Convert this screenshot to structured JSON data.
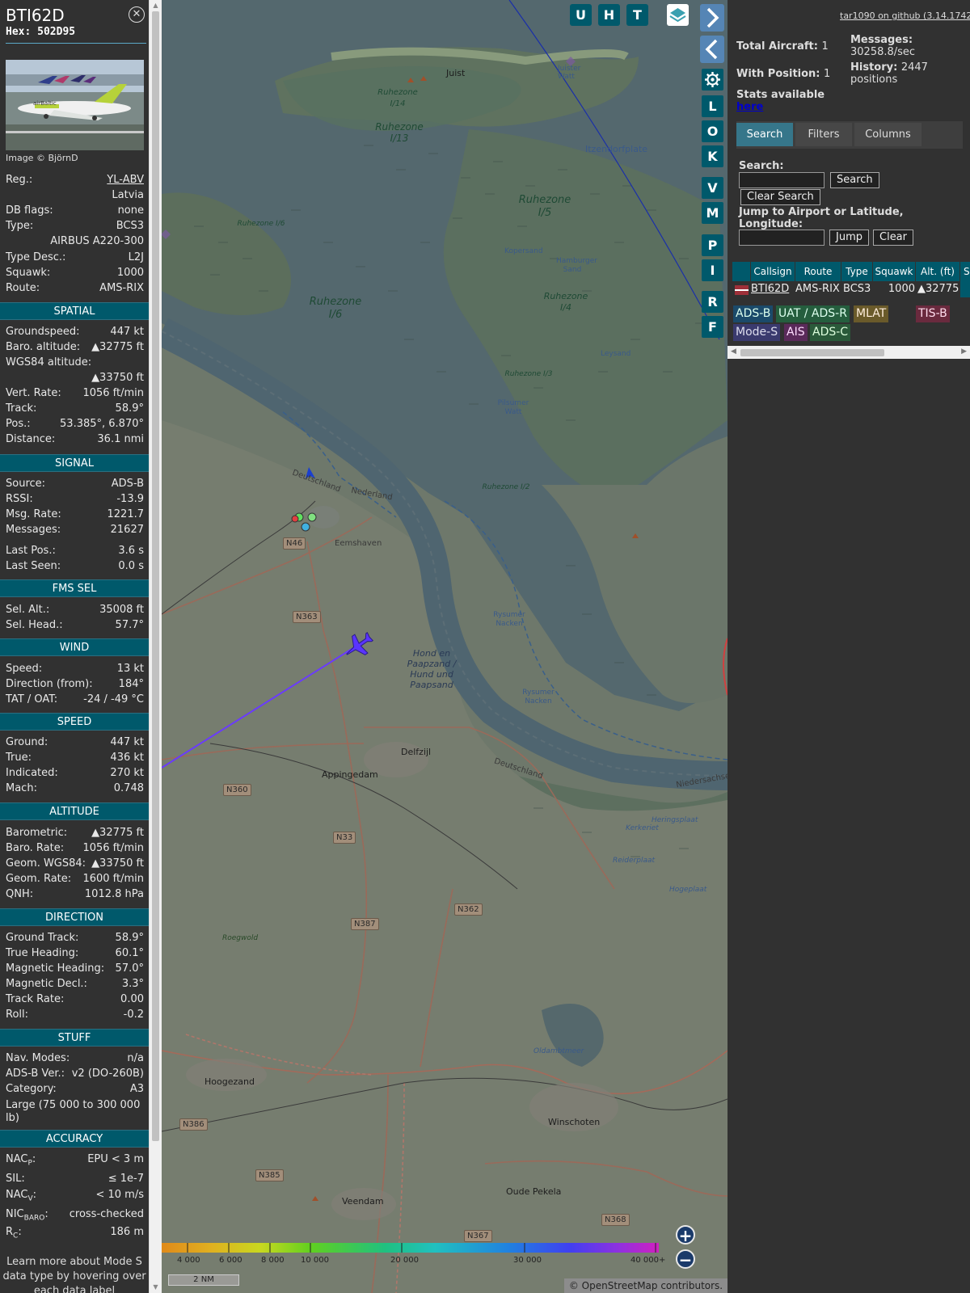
{
  "sidebar": {
    "callsign": "BTI62D",
    "hex": "Hex: 502D95",
    "image_credit": "Image © BjörnD",
    "basic": [
      {
        "k": "Reg.:",
        "v": "YL-ABV"
      },
      {
        "k": "",
        "v": "Latvia"
      },
      {
        "k": "DB flags:",
        "v": "none"
      },
      {
        "k": "Type:",
        "v": "BCS3"
      },
      {
        "k": "",
        "v": "AIRBUS A220-300"
      },
      {
        "k": "Type Desc.:",
        "v": "L2J"
      },
      {
        "k": "Squawk:",
        "v": "1000"
      },
      {
        "k": "Route:",
        "v": "AMS-RIX"
      }
    ],
    "sections": {
      "spatial": "SPATIAL",
      "signal": "SIGNAL",
      "fms": "FMS SEL",
      "wind": "WIND",
      "speed": "SPEED",
      "altitude": "ALTITUDE",
      "direction": "DIRECTION",
      "stuff": "STUFF",
      "accuracy": "ACCURACY"
    },
    "spatial": [
      {
        "k": "Groundspeed:",
        "v": "447 kt"
      },
      {
        "k": "Baro. altitude:",
        "v": "▲32775 ft"
      },
      {
        "k": "WGS84 altitude:",
        "v": ""
      },
      {
        "k": "",
        "v": "▲33750 ft"
      },
      {
        "k": "Vert. Rate:",
        "v": "1056 ft/min"
      },
      {
        "k": "Track:",
        "v": "58.9°"
      },
      {
        "k": "Pos.:",
        "v": "53.385°, 6.870°"
      },
      {
        "k": "Distance:",
        "v": "36.1 nmi"
      }
    ],
    "signal": [
      {
        "k": "Source:",
        "v": "ADS-B"
      },
      {
        "k": "RSSI:",
        "v": "-13.9"
      },
      {
        "k": "Msg. Rate:",
        "v": "1221.7"
      },
      {
        "k": "Messages:",
        "v": "21627"
      },
      {
        "k": "Last Pos.:",
        "v": "3.6 s"
      },
      {
        "k": "Last Seen:",
        "v": "0.0 s"
      }
    ],
    "fms": [
      {
        "k": "Sel. Alt.:",
        "v": "35008 ft"
      },
      {
        "k": "Sel. Head.:",
        "v": "57.7°"
      }
    ],
    "wind": [
      {
        "k": "Speed:",
        "v": "13 kt"
      },
      {
        "k": "Direction (from):",
        "v": "184°"
      },
      {
        "k": "TAT / OAT:",
        "v": "-24 / -49 °C"
      }
    ],
    "speed": [
      {
        "k": "Ground:",
        "v": "447 kt"
      },
      {
        "k": "True:",
        "v": "436 kt"
      },
      {
        "k": "Indicated:",
        "v": "270 kt"
      },
      {
        "k": "Mach:",
        "v": "0.748"
      }
    ],
    "altitude": [
      {
        "k": "Barometric:",
        "v": "▲32775 ft"
      },
      {
        "k": "Baro. Rate:",
        "v": "1056 ft/min"
      },
      {
        "k": "Geom. WGS84:",
        "v": "▲33750 ft"
      },
      {
        "k": "Geom. Rate:",
        "v": "1600 ft/min"
      },
      {
        "k": "QNH:",
        "v": "1012.8 hPa"
      }
    ],
    "direction": [
      {
        "k": "Ground Track:",
        "v": "58.9°"
      },
      {
        "k": "True Heading:",
        "v": "60.1°"
      },
      {
        "k": "Magnetic Heading:",
        "v": "57.0°"
      },
      {
        "k": "Magnetic Decl.:",
        "v": "3.3°"
      },
      {
        "k": "Track Rate:",
        "v": "0.00"
      },
      {
        "k": "Roll:",
        "v": "-0.2"
      }
    ],
    "stuff": [
      {
        "k": "Nav. Modes:",
        "v": "n/a"
      },
      {
        "k": "ADS-B Ver.:",
        "v": "v2 (DO-260B)"
      },
      {
        "k": "Category:",
        "v": "A3"
      }
    ],
    "category_desc": "Large (75 000 to 300 000 lb)",
    "accuracy": [
      {
        "k": "NAC",
        "sub": "P",
        "v": "EPU < 3 m"
      },
      {
        "k": "SIL:",
        "sub": "",
        "v": "≤ 1e-7"
      },
      {
        "k": "NAC",
        "sub": "V",
        "v": "< 10 m/s"
      },
      {
        "k": "NIC",
        "sub": "BARO",
        "v": "cross-checked"
      },
      {
        "k": "R",
        "sub": "C",
        "v": "186 m"
      }
    ],
    "footnote": "Learn more about Mode S data type by hovering over each data label"
  },
  "map": {
    "top_buttons": [
      "U",
      "H",
      "T"
    ],
    "layer_buttons": [
      "L",
      "O",
      "K",
      "V",
      "M",
      "P",
      "I",
      "R",
      "F"
    ],
    "labels": [
      {
        "t": "Juist"
      },
      {
        "t": "Juister Watt"
      },
      {
        "t": "Itzendorfplate"
      },
      {
        "t": "Kopersand"
      },
      {
        "t": "Hamburger Sand"
      },
      {
        "t": "Leysand"
      },
      {
        "t": "Pilsumer Watt"
      },
      {
        "t": "Deutschland"
      },
      {
        "t": "Nederland"
      },
      {
        "t": "Eemshaven"
      },
      {
        "t": "Rysumer Nacken"
      },
      {
        "t": "Rysumer Nacken"
      },
      {
        "t": "Delfzijl"
      },
      {
        "t": "Appingedam"
      },
      {
        "t": "Deutschland"
      },
      {
        "t": "Niedersachsen"
      },
      {
        "t": "Heringsplaat"
      },
      {
        "t": "Kerkeriet"
      },
      {
        "t": "Reiderplaat"
      },
      {
        "t": "Hogeplaat"
      },
      {
        "t": "Roegwold"
      },
      {
        "t": "Oldambtmeer"
      },
      {
        "t": "Hoogezand"
      },
      {
        "t": "Winschoten"
      },
      {
        "t": "Oude Pekela"
      },
      {
        "t": "Veendam"
      }
    ],
    "zones": [
      "Ruhezone I/14",
      "Ruhezone I/13",
      "Ruhezone I/5",
      "Ruhezone I/6",
      "Ruhezone I/6",
      "Ruhezone I/4",
      "Ruhezone I/3",
      "Ruhezone I/2",
      "Hond en Paapzand / Hund und Paapsand"
    ],
    "roads": [
      "N46",
      "N363",
      "N360",
      "N33",
      "N387",
      "N362",
      "N386",
      "N385",
      "N367",
      "N368"
    ],
    "color_scale": [
      "4 000",
      "6 000",
      "8 000",
      "10 000",
      "20 000",
      "30 000",
      "40 000+"
    ],
    "scale_bar": "2 NM",
    "attribution": "© OpenStreetMap contributors."
  },
  "right": {
    "github": "tar1090 on github (3.14.1742)",
    "total_aircraft_label": "Total Aircraft:",
    "total_aircraft": "1",
    "with_position_label": "With Position:",
    "with_position": "1",
    "messages_label": "Messages:",
    "messages": "30258.8/sec",
    "history_label": "History:",
    "history": "2447 positions",
    "stats_label": "Stats available",
    "stats_link": "here",
    "tabs": [
      "Search",
      "Filters",
      "Columns"
    ],
    "search_label": "Search:",
    "search_btn": "Search",
    "clear_search_btn": "Clear Search",
    "jump_label": "Jump to Airport or Latitude, Longitude:",
    "jump_btn": "Jump",
    "clear_btn": "Clear",
    "table": {
      "headers": [
        "Callsign",
        "Route",
        "Type",
        "Squawk",
        "Alt. (ft)",
        "S"
      ],
      "row": {
        "callsign": "BTI62D",
        "route": "AMS-RIX",
        "type": "BCS3",
        "squawk": "1000",
        "alt": "▲32775"
      }
    },
    "sources": [
      "ADS-B",
      "UAT / ADS-R",
      "MLAT",
      "TIS-B",
      "Mode-S",
      "AIS",
      "ADS-C"
    ]
  }
}
